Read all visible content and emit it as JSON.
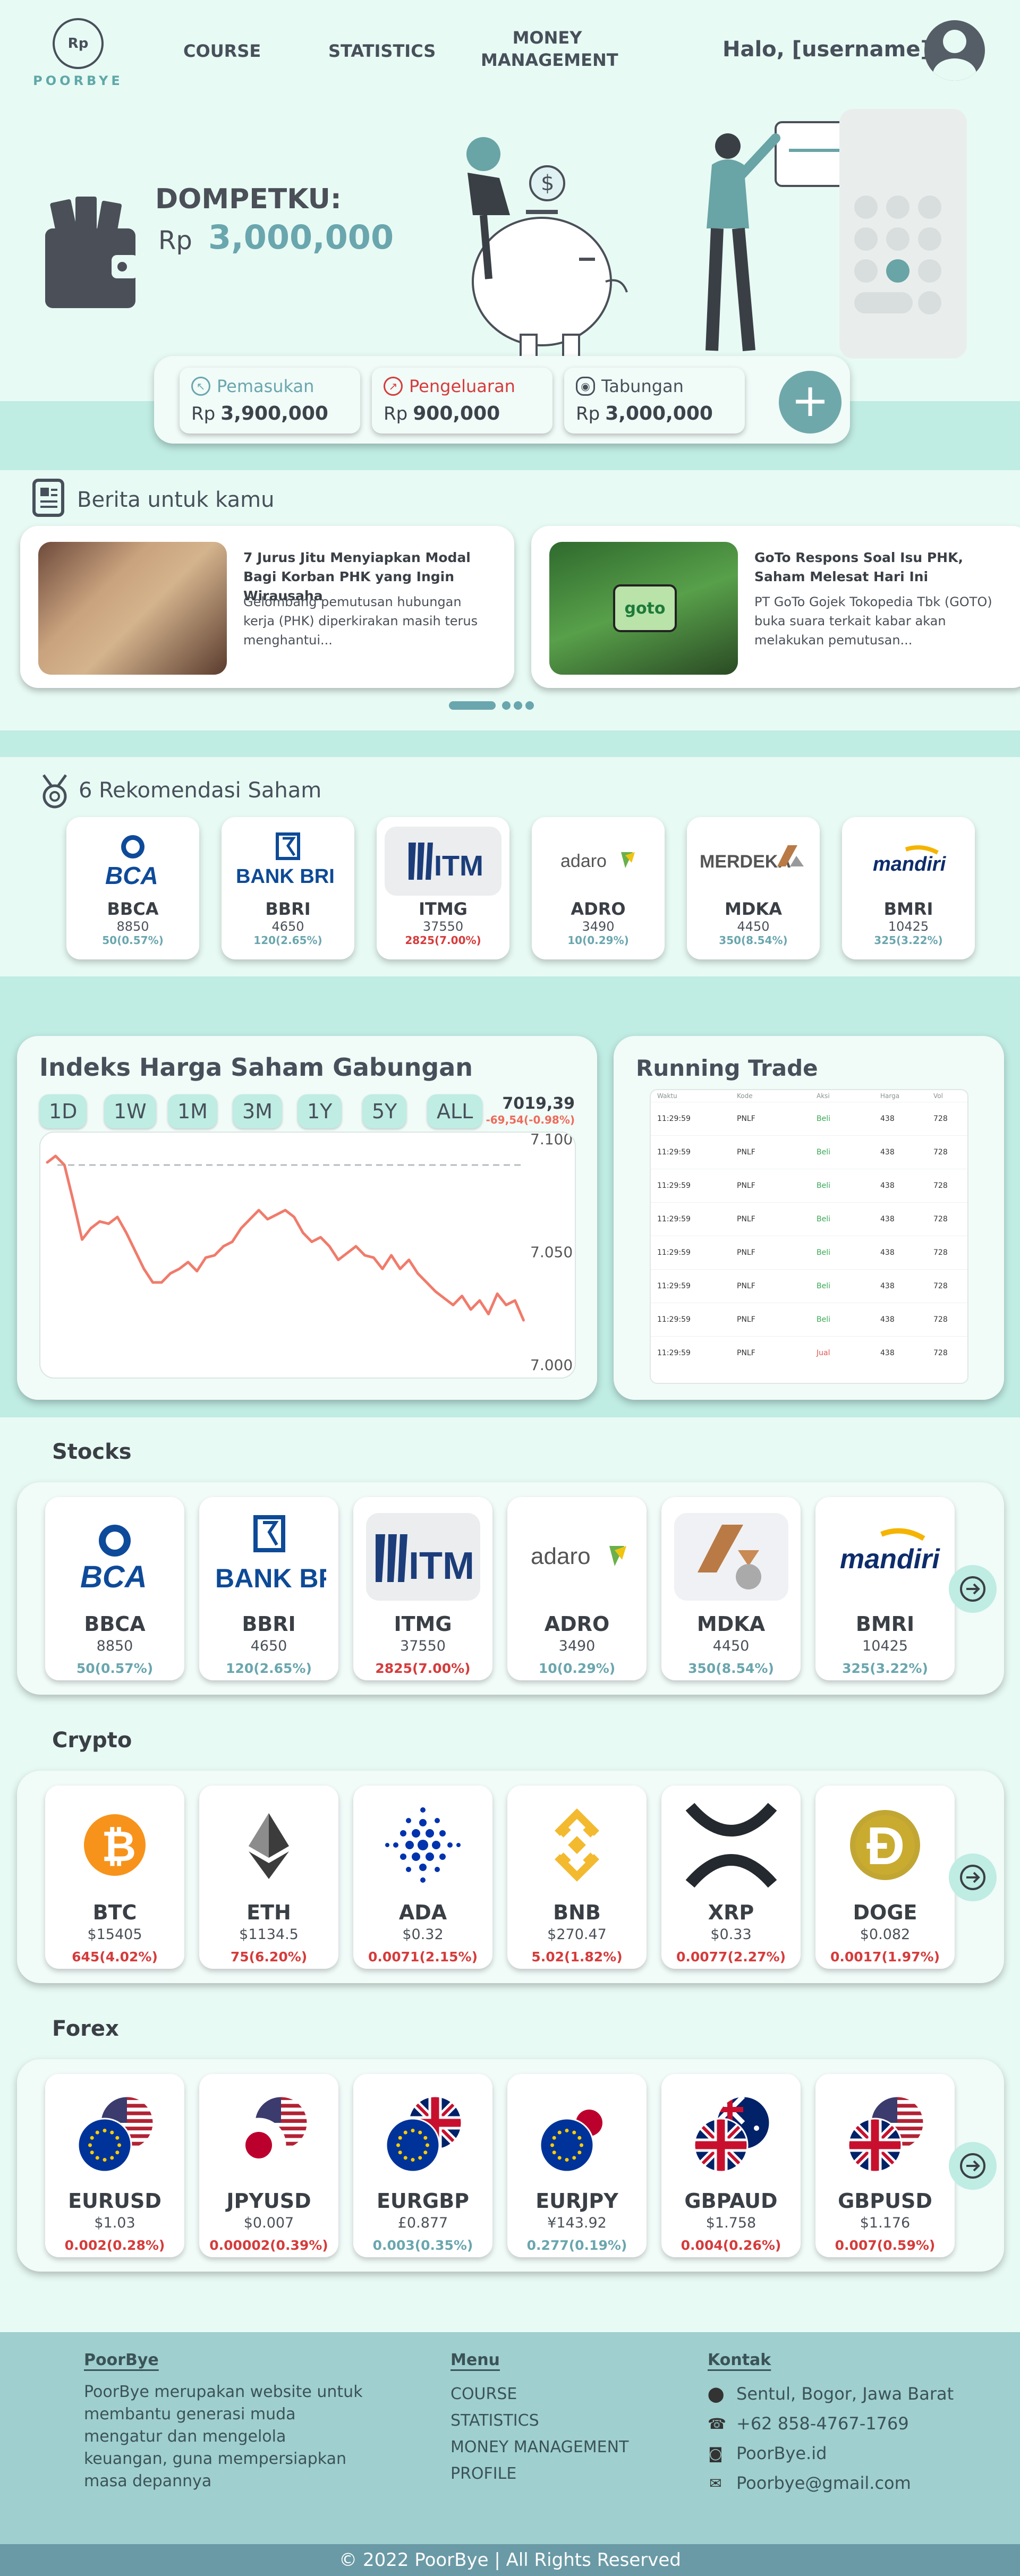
{
  "brand": {
    "logo_symbol": "Rp",
    "name": "POORBYE"
  },
  "nav": {
    "links": [
      "COURSE",
      "STATISTICS",
      "MONEY MANAGEMENT"
    ],
    "greeting": "Halo, [username]!"
  },
  "wallet": {
    "title": "DOMPETKU:",
    "currency": "Rp",
    "amount": "3,000,000"
  },
  "summary": [
    {
      "label": "Pemasukan",
      "currency": "Rp",
      "amount": "3,900,000",
      "color": "#6aa6ae",
      "icon": "arrow-in-icon"
    },
    {
      "label": "Pengeluaran",
      "currency": "Rp",
      "amount": "900,000",
      "color": "#d63b3b",
      "icon": "arrow-out-icon"
    },
    {
      "label": "Tabungan",
      "currency": "Rp",
      "amount": "3,000,000",
      "color": "#47505a",
      "icon": "piggy-icon"
    }
  ],
  "add_button": "+",
  "news": {
    "title": "Berita untuk kamu",
    "items": [
      {
        "headline": "7 Jurus Jitu Menyiapkan Modal Bagi Korban PHK yang Ingin Wirausaha",
        "excerpt": "Gelombang pemutusan hubungan kerja (PHK) diperkirakan masih terus menghantui..."
      },
      {
        "headline": "GoTo Respons Soal Isu PHK, Saham Melesat Hari Ini",
        "excerpt": "PT GoTo Gojek Tokopedia Tbk (GOTO) buka suara terkait kabar akan melakukan pemutusan..."
      }
    ]
  },
  "recommend": {
    "title": "6 Rekomendasi Saham",
    "items": [
      {
        "code": "BBCA",
        "price": "8850",
        "change": "50(0.57%)",
        "dir": "up",
        "logo": "BCA"
      },
      {
        "code": "BBRI",
        "price": "4650",
        "change": "120(2.65%)",
        "dir": "up",
        "logo": "BANK BRI"
      },
      {
        "code": "ITMG",
        "price": "37550",
        "change": "2825(7.00%)",
        "dir": "down",
        "logo": "ITM"
      },
      {
        "code": "ADRO",
        "price": "3490",
        "change": "10(0.29%)",
        "dir": "up",
        "logo": "adaro"
      },
      {
        "code": "MDKA",
        "price": "4450",
        "change": "350(8.54%)",
        "dir": "up",
        "logo": "MERDEKA"
      },
      {
        "code": "BMRI",
        "price": "10425",
        "change": "325(3.22%)",
        "dir": "up",
        "logo": "mandiri"
      }
    ]
  },
  "ihsg": {
    "title": "Indeks Harga Saham Gabungan",
    "ranges": [
      "1D",
      "1W",
      "1M",
      "3M",
      "1Y",
      "5Y",
      "ALL"
    ],
    "value": "7019,39",
    "change": "-69,54(-0.98%)"
  },
  "chart_data": {
    "type": "line",
    "title": "Indeks Harga Saham Gabungan",
    "xlabel": "",
    "ylabel": "",
    "ylim": [
      7000,
      7100
    ],
    "yticks": [
      "7.100",
      "7.050",
      "7.000"
    ],
    "reference_line": 7088,
    "color": "#f07b6b",
    "values": [
      7089,
      7092,
      7088,
      7072,
      7055,
      7060,
      7063,
      7062,
      7065,
      7058,
      7050,
      7042,
      7036,
      7036,
      7040,
      7042,
      7045,
      7041,
      7047,
      7048,
      7052,
      7054,
      7060,
      7064,
      7068,
      7064,
      7066,
      7068,
      7065,
      7058,
      7054,
      7056,
      7052,
      7046,
      7049,
      7052,
      7048,
      7047,
      7042,
      7048,
      7042,
      7046,
      7040,
      7036,
      7032,
      7029,
      7026,
      7030,
      7024,
      7028,
      7022,
      7031,
      7026,
      7028,
      7019
    ]
  },
  "running_trade": {
    "title": "Running Trade",
    "headers": [
      "Waktu",
      "Kode",
      "Aksi",
      "Harga",
      "Vol"
    ],
    "rows": [
      {
        "time": "11:29:59",
        "code": "PNLF",
        "action": "Beli",
        "price": "438",
        "vol": "728"
      },
      {
        "time": "11:29:59",
        "code": "PNLF",
        "action": "Beli",
        "price": "438",
        "vol": "728"
      },
      {
        "time": "11:29:59",
        "code": "PNLF",
        "action": "Beli",
        "price": "438",
        "vol": "728"
      },
      {
        "time": "11:29:59",
        "code": "PNLF",
        "action": "Beli",
        "price": "438",
        "vol": "728"
      },
      {
        "time": "11:29:59",
        "code": "PNLF",
        "action": "Beli",
        "price": "438",
        "vol": "728"
      },
      {
        "time": "11:29:59",
        "code": "PNLF",
        "action": "Beli",
        "price": "438",
        "vol": "728"
      },
      {
        "time": "11:29:59",
        "code": "PNLF",
        "action": "Beli",
        "price": "438",
        "vol": "728"
      },
      {
        "time": "11:29:59",
        "code": "PNLF",
        "action": "Jual",
        "price": "438",
        "vol": "728"
      }
    ]
  },
  "stocks": {
    "title": "Stocks",
    "items": [
      {
        "code": "BBCA",
        "price": "8850",
        "change": "50(0.57%)",
        "dir": "up",
        "logo": "BCA"
      },
      {
        "code": "BBRI",
        "price": "4650",
        "change": "120(2.65%)",
        "dir": "up",
        "logo": "BANK BRI"
      },
      {
        "code": "ITMG",
        "price": "37550",
        "change": "2825(7.00%)",
        "dir": "down",
        "logo": "ITM"
      },
      {
        "code": "ADRO",
        "price": "3490",
        "change": "10(0.29%)",
        "dir": "up",
        "logo": "adaro"
      },
      {
        "code": "MDKA",
        "price": "4450",
        "change": "350(8.54%)",
        "dir": "up",
        "logo": ""
      },
      {
        "code": "BMRI",
        "price": "10425",
        "change": "325(3.22%)",
        "dir": "up",
        "logo": "mandiri"
      }
    ]
  },
  "crypto": {
    "title": "Crypto",
    "items": [
      {
        "code": "BTC",
        "price": "$15405",
        "change": "645(4.02%)",
        "dir": "down"
      },
      {
        "code": "ETH",
        "price": "$1134.5",
        "change": "75(6.20%)",
        "dir": "down"
      },
      {
        "code": "ADA",
        "price": "$0.32",
        "change": "0.0071(2.15%)",
        "dir": "down"
      },
      {
        "code": "BNB",
        "price": "$270.47",
        "change": "5.02(1.82%)",
        "dir": "down"
      },
      {
        "code": "XRP",
        "price": "$0.33",
        "change": "0.0077(2.27%)",
        "dir": "down"
      },
      {
        "code": "DOGE",
        "price": "$0.082",
        "change": "0.0017(1.97%)",
        "dir": "down"
      }
    ]
  },
  "forex": {
    "title": "Forex",
    "items": [
      {
        "code": "EURUSD",
        "price": "$1.03",
        "change": "0.002(0.28%)",
        "dir": "down"
      },
      {
        "code": "JPYUSD",
        "price": "$0.007",
        "change": "0.00002(0.39%)",
        "dir": "down"
      },
      {
        "code": "EURGBP",
        "price": "£0.877",
        "change": "0.003(0.35%)",
        "dir": "up"
      },
      {
        "code": "EURJPY",
        "price": "¥143.92",
        "change": "0.277(0.19%)",
        "dir": "up"
      },
      {
        "code": "GBPAUD",
        "price": "$1.758",
        "change": "0.004(0.26%)",
        "dir": "down"
      },
      {
        "code": "GBPUSD",
        "price": "$1.176",
        "change": "0.007(0.59%)",
        "dir": "down"
      }
    ]
  },
  "footer": {
    "about_title": "PoorBye",
    "about_text": "PoorBye merupakan website untuk membantu generasi muda mengatur dan mengelola keuangan, guna mempersiapkan masa depannya",
    "menu_title": "Menu",
    "menu": [
      "COURSE",
      "STATISTICS",
      "MONEY MANAGEMENT",
      "PROFILE"
    ],
    "contact_title": "Kontak",
    "contacts": [
      {
        "icon": "location-icon",
        "text": "Sentul, Bogor, Jawa Barat"
      },
      {
        "icon": "phone-icon",
        "text": "+62 858-4767-1769"
      },
      {
        "icon": "instagram-icon",
        "text": "PoorBye.id"
      },
      {
        "icon": "mail-icon",
        "text": "Poorbye@gmail.com"
      }
    ],
    "copyright": "© 2022 PoorBye | All Rights Reserved"
  }
}
